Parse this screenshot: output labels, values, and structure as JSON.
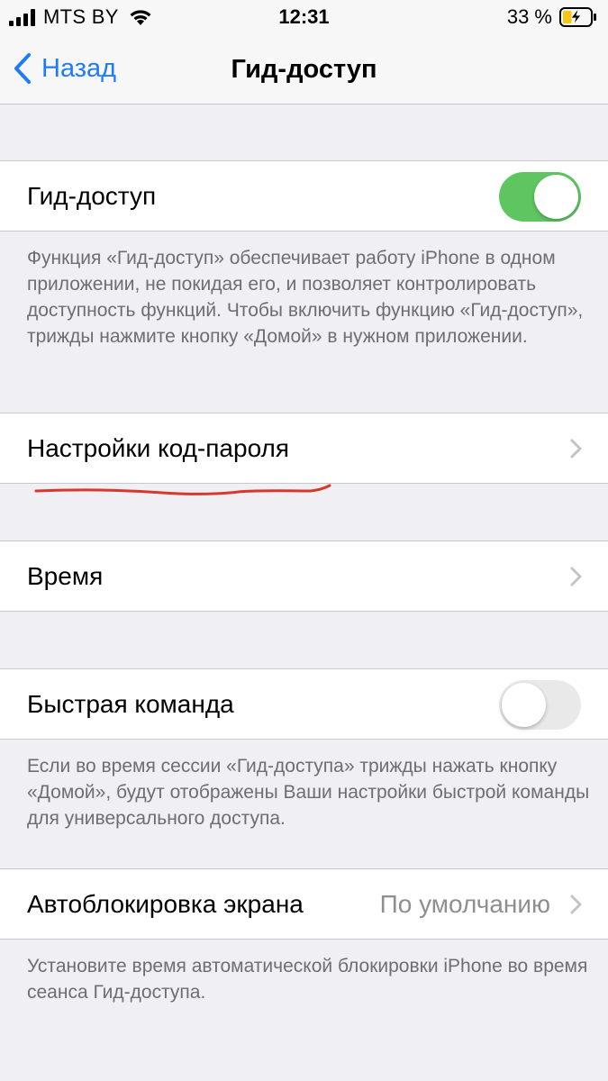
{
  "status_bar": {
    "carrier": "MTS BY",
    "time": "12:31",
    "battery_percent": "33 %",
    "battery_level": 0.33,
    "icons": [
      "signal-icon",
      "wifi-icon",
      "battery-charging-icon"
    ]
  },
  "nav": {
    "back_label": "Назад",
    "title": "Гид-доступ"
  },
  "guided_access": {
    "label": "Гид-доступ",
    "enabled": true,
    "footer": "Функция «Гид-доступ» обеспечивает работу iPhone в одном приложении, не покидая его, и позволяет контролировать доступность функций. Чтобы включить функцию «Гид-доступ», трижды нажмите кнопку «Домой» в нужном приложении."
  },
  "passcode_settings": {
    "label": "Настройки код-пароля"
  },
  "time_limits": {
    "label": "Время"
  },
  "accessibility_shortcut": {
    "label": "Быстрая команда",
    "enabled": false,
    "footer": "Если во время сессии «Гид-доступа» трижды нажать кнопку «Домой», будут отображены Ваши настройки быстрой команды для универсального доступа."
  },
  "auto_lock": {
    "label": "Автоблокировка экрана",
    "value": "По умолчанию",
    "footer": "Установите время автоматической блокировки iPhone во время сеанса Гид-доступа."
  },
  "colors": {
    "accent": "#1f7bf6",
    "toggle_on": "#5fc561",
    "annotation": "#d9372b"
  }
}
